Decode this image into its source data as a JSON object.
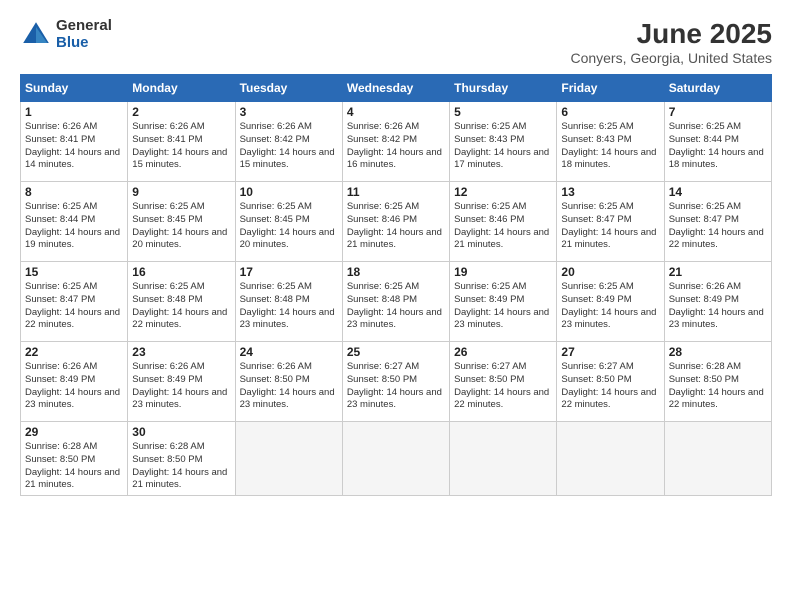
{
  "logo": {
    "general": "General",
    "blue": "Blue"
  },
  "title": "June 2025",
  "location": "Conyers, Georgia, United States",
  "days_of_week": [
    "Sunday",
    "Monday",
    "Tuesday",
    "Wednesday",
    "Thursday",
    "Friday",
    "Saturday"
  ],
  "weeks": [
    [
      {
        "day": "1",
        "sunrise": "6:26 AM",
        "sunset": "8:41 PM",
        "daylight": "14 hours and 14 minutes."
      },
      {
        "day": "2",
        "sunrise": "6:26 AM",
        "sunset": "8:41 PM",
        "daylight": "14 hours and 15 minutes."
      },
      {
        "day": "3",
        "sunrise": "6:26 AM",
        "sunset": "8:42 PM",
        "daylight": "14 hours and 15 minutes."
      },
      {
        "day": "4",
        "sunrise": "6:26 AM",
        "sunset": "8:42 PM",
        "daylight": "14 hours and 16 minutes."
      },
      {
        "day": "5",
        "sunrise": "6:25 AM",
        "sunset": "8:43 PM",
        "daylight": "14 hours and 17 minutes."
      },
      {
        "day": "6",
        "sunrise": "6:25 AM",
        "sunset": "8:43 PM",
        "daylight": "14 hours and 18 minutes."
      },
      {
        "day": "7",
        "sunrise": "6:25 AM",
        "sunset": "8:44 PM",
        "daylight": "14 hours and 18 minutes."
      }
    ],
    [
      {
        "day": "8",
        "sunrise": "6:25 AM",
        "sunset": "8:44 PM",
        "daylight": "14 hours and 19 minutes."
      },
      {
        "day": "9",
        "sunrise": "6:25 AM",
        "sunset": "8:45 PM",
        "daylight": "14 hours and 20 minutes."
      },
      {
        "day": "10",
        "sunrise": "6:25 AM",
        "sunset": "8:45 PM",
        "daylight": "14 hours and 20 minutes."
      },
      {
        "day": "11",
        "sunrise": "6:25 AM",
        "sunset": "8:46 PM",
        "daylight": "14 hours and 21 minutes."
      },
      {
        "day": "12",
        "sunrise": "6:25 AM",
        "sunset": "8:46 PM",
        "daylight": "14 hours and 21 minutes."
      },
      {
        "day": "13",
        "sunrise": "6:25 AM",
        "sunset": "8:47 PM",
        "daylight": "14 hours and 21 minutes."
      },
      {
        "day": "14",
        "sunrise": "6:25 AM",
        "sunset": "8:47 PM",
        "daylight": "14 hours and 22 minutes."
      }
    ],
    [
      {
        "day": "15",
        "sunrise": "6:25 AM",
        "sunset": "8:47 PM",
        "daylight": "14 hours and 22 minutes."
      },
      {
        "day": "16",
        "sunrise": "6:25 AM",
        "sunset": "8:48 PM",
        "daylight": "14 hours and 22 minutes."
      },
      {
        "day": "17",
        "sunrise": "6:25 AM",
        "sunset": "8:48 PM",
        "daylight": "14 hours and 23 minutes."
      },
      {
        "day": "18",
        "sunrise": "6:25 AM",
        "sunset": "8:48 PM",
        "daylight": "14 hours and 23 minutes."
      },
      {
        "day": "19",
        "sunrise": "6:25 AM",
        "sunset": "8:49 PM",
        "daylight": "14 hours and 23 minutes."
      },
      {
        "day": "20",
        "sunrise": "6:25 AM",
        "sunset": "8:49 PM",
        "daylight": "14 hours and 23 minutes."
      },
      {
        "day": "21",
        "sunrise": "6:26 AM",
        "sunset": "8:49 PM",
        "daylight": "14 hours and 23 minutes."
      }
    ],
    [
      {
        "day": "22",
        "sunrise": "6:26 AM",
        "sunset": "8:49 PM",
        "daylight": "14 hours and 23 minutes."
      },
      {
        "day": "23",
        "sunrise": "6:26 AM",
        "sunset": "8:49 PM",
        "daylight": "14 hours and 23 minutes."
      },
      {
        "day": "24",
        "sunrise": "6:26 AM",
        "sunset": "8:50 PM",
        "daylight": "14 hours and 23 minutes."
      },
      {
        "day": "25",
        "sunrise": "6:27 AM",
        "sunset": "8:50 PM",
        "daylight": "14 hours and 23 minutes."
      },
      {
        "day": "26",
        "sunrise": "6:27 AM",
        "sunset": "8:50 PM",
        "daylight": "14 hours and 22 minutes."
      },
      {
        "day": "27",
        "sunrise": "6:27 AM",
        "sunset": "8:50 PM",
        "daylight": "14 hours and 22 minutes."
      },
      {
        "day": "28",
        "sunrise": "6:28 AM",
        "sunset": "8:50 PM",
        "daylight": "14 hours and 22 minutes."
      }
    ],
    [
      {
        "day": "29",
        "sunrise": "6:28 AM",
        "sunset": "8:50 PM",
        "daylight": "14 hours and 21 minutes."
      },
      {
        "day": "30",
        "sunrise": "6:28 AM",
        "sunset": "8:50 PM",
        "daylight": "14 hours and 21 minutes."
      },
      null,
      null,
      null,
      null,
      null
    ]
  ]
}
